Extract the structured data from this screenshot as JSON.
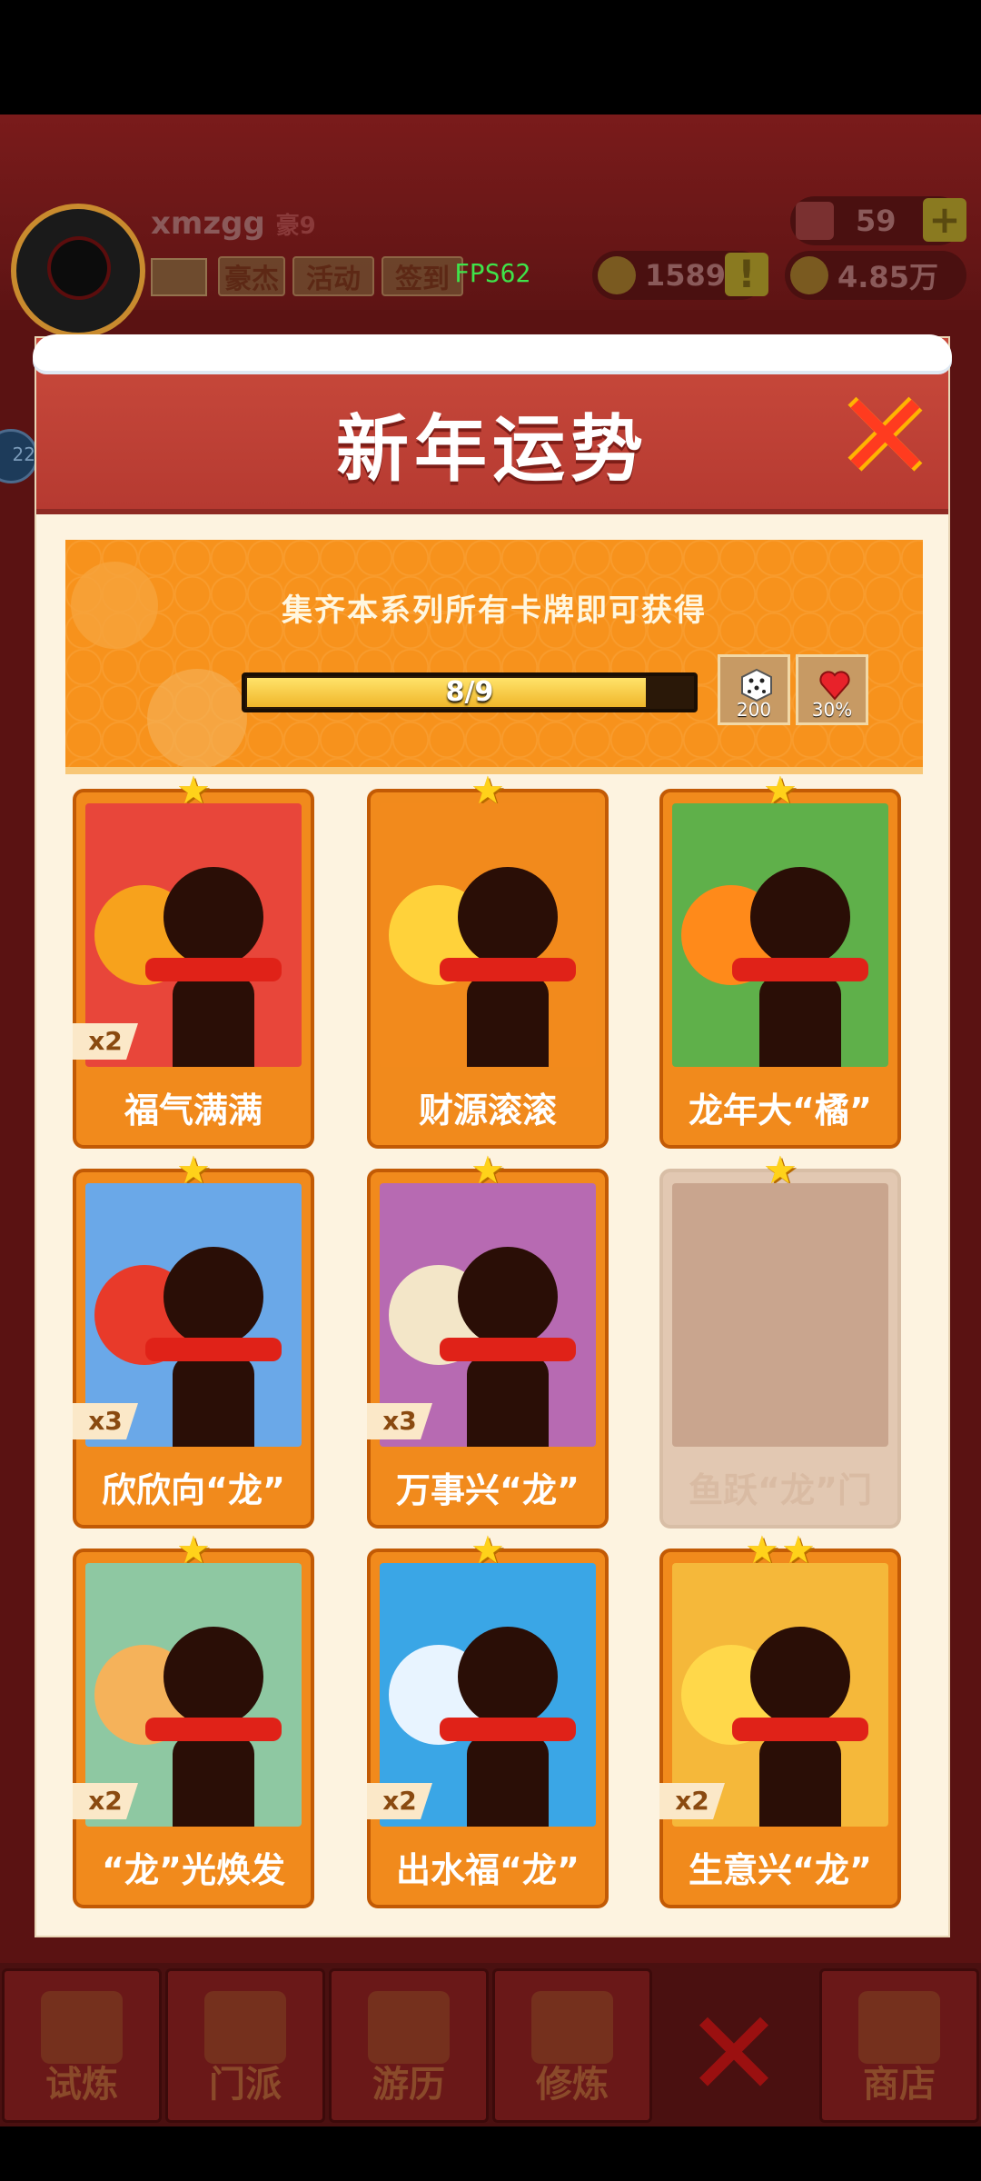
{
  "background": {
    "player": {
      "name": "xmzgg",
      "rank_badge": "豪9",
      "tags": [
        "豪杰",
        "活动",
        "签到"
      ],
      "fps": "FPS62"
    },
    "resources": {
      "gems": "59",
      "coins_a": "1589",
      "coins_b": "4.85万"
    },
    "side_badge": "22",
    "nav": [
      {
        "label": "试炼"
      },
      {
        "label": "门派"
      },
      {
        "label": "游历"
      },
      {
        "label": "修炼"
      },
      {
        "label": "商店"
      }
    ]
  },
  "modal": {
    "title": "新年运势",
    "close_icon": "close-x",
    "banner": {
      "text": "集齐本系列所有卡牌即可获得",
      "progress_text": "8/9",
      "progress_fraction": 0.889,
      "rewards": [
        {
          "icon": "dice-icon",
          "value": "200"
        },
        {
          "icon": "heart-icon",
          "value": "30%"
        }
      ]
    },
    "cards": [
      {
        "label": "福气满满",
        "count": "x2",
        "stars": 1,
        "locked": false,
        "art_color": "#e8463a",
        "prop_color": "#f7a21c"
      },
      {
        "label": "财源滚滚",
        "count": "",
        "stars": 1,
        "locked": false,
        "art_color": "#f28a1c",
        "prop_color": "#ffd23a"
      },
      {
        "label": "龙年大“橘”",
        "count": "",
        "stars": 1,
        "locked": false,
        "art_color": "#5fb04a",
        "prop_color": "#ff8a1a"
      },
      {
        "label": "欣欣向“龙”",
        "count": "x3",
        "stars": 1,
        "locked": false,
        "art_color": "#6aa8e8",
        "prop_color": "#e83a2a"
      },
      {
        "label": "万事兴“龙”",
        "count": "x3",
        "stars": 1,
        "locked": false,
        "art_color": "#b76ab2",
        "prop_color": "#f3e6c8"
      },
      {
        "label": "鱼跃“龙”门",
        "count": "",
        "stars": 1,
        "locked": true,
        "art_color": "#c9a58e",
        "prop_color": "#c9a58e"
      },
      {
        "label": "“龙”光焕发",
        "count": "x2",
        "stars": 1,
        "locked": false,
        "art_color": "#8ec8a2",
        "prop_color": "#f5b25a"
      },
      {
        "label": "出水福“龙”",
        "count": "x2",
        "stars": 1,
        "locked": false,
        "art_color": "#3aa6e6",
        "prop_color": "#e8f4ff"
      },
      {
        "label": "生意兴“龙”",
        "count": "x2",
        "stars": 2,
        "locked": false,
        "art_color": "#f5b83a",
        "prop_color": "#ffd84a"
      }
    ]
  }
}
